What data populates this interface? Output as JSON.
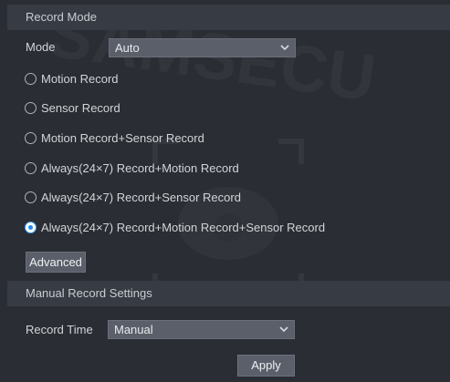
{
  "record_mode": {
    "header": "Record Mode",
    "mode_label": "Mode",
    "mode_value": "Auto",
    "options": [
      {
        "label": "Motion Record",
        "checked": false
      },
      {
        "label": "Sensor Record",
        "checked": false
      },
      {
        "label": "Motion Record+Sensor Record",
        "checked": false
      },
      {
        "label": "Always(24×7) Record+Motion Record",
        "checked": false
      },
      {
        "label": "Always(24×7) Record+Sensor Record",
        "checked": false
      },
      {
        "label": "Always(24×7) Record+Motion Record+Sensor Record",
        "checked": true
      }
    ],
    "advanced_label": "Advanced"
  },
  "manual_record": {
    "header": "Manual Record Settings",
    "record_time_label": "Record Time",
    "record_time_value": "Manual",
    "apply_label": "Apply"
  },
  "colors": {
    "background": "#2a2d33",
    "header_bg": "#373b43",
    "control_bg": "#5a5f69",
    "radio_selected": "#2187f0"
  },
  "icons": {
    "dropdown": "chevron-down-icon",
    "option_unselected": "radio-unchecked-icon",
    "option_selected": "radio-checked-icon"
  }
}
